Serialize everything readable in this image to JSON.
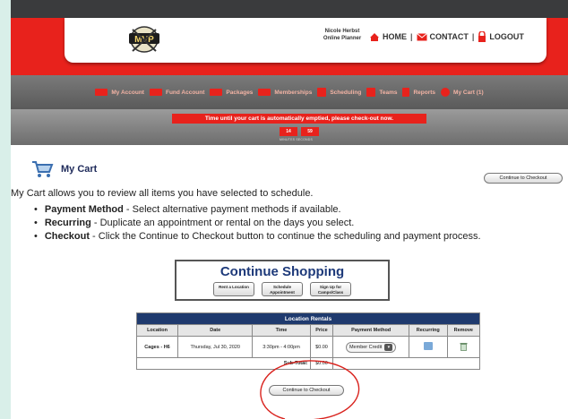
{
  "header": {
    "user_name": "Nicole Herbst",
    "user_role": "Online Planner",
    "links": {
      "home": "HOME",
      "contact": "CONTACT",
      "logout": "LOGOUT"
    }
  },
  "nav": {
    "items": [
      "My Account",
      "Fund Account",
      "Packages",
      "Memberships",
      "Scheduling",
      "Teams",
      "Reports",
      "My Cart (1)"
    ]
  },
  "cart_timer": {
    "notice": "Time until your cart is automatically emptied, please check-out now.",
    "minutes": "14",
    "seconds": "59",
    "labels": "MINUTES   SECONDS"
  },
  "page": {
    "title": "My Cart",
    "checkout_label": "Continue to Checkout",
    "intro": "My Cart allows you to review all items you have selected to schedule.",
    "bullets": [
      {
        "term": "Payment Method",
        "text": " - Select alternative payment methods if available."
      },
      {
        "term": "Recurring",
        "text": " - Duplicate an appointment or rental on the days you select."
      },
      {
        "term": "Checkout",
        "text": " - Click the Continue to Checkout button to continue the scheduling and payment process."
      }
    ]
  },
  "shopping": {
    "title": "Continue Shopping",
    "buttons": [
      "Rent a Location",
      "Schedule Appointment",
      "Sign Up for Camps/Class"
    ]
  },
  "rentals": {
    "title": "Location Rentals",
    "columns": [
      "Location",
      "Date",
      "Time",
      "Price",
      "Payment Method",
      "Recurring",
      "Remove"
    ],
    "row": {
      "location": "Cages - H6",
      "date": "Thursday, Jul 30, 2020",
      "time": "3:30pm - 4:00pm",
      "price": "$0.00",
      "payment_method": "Member Credit"
    },
    "subtotal_label": "Sub-Total:",
    "subtotal_value": "$0.00"
  },
  "colors": {
    "brand_red": "#e8221c",
    "navy": "#1f3a6e",
    "annotation": "#d9231e"
  }
}
